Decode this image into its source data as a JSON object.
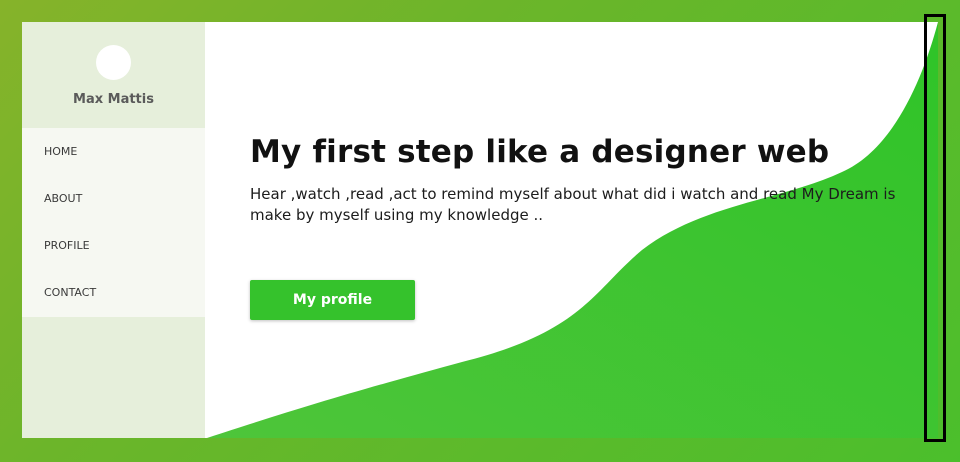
{
  "sidebar": {
    "user_name": "Max Mattis",
    "items": [
      {
        "label": "HOME"
      },
      {
        "label": "ABOUT"
      },
      {
        "label": "PROFILE"
      },
      {
        "label": "CONTACT"
      }
    ]
  },
  "hero": {
    "title": "My first step like a designer web",
    "description": "Hear ,watch ,read ,act to remind myself about what did i watch and read My Dream is make by myself using my knowledge ..",
    "button_label": "My profile"
  },
  "colors": {
    "accent": "#35c22c",
    "frame_background": "#6cb52a",
    "sidebar_background": "#e6efdb",
    "nav_background": "#f6f8f2"
  },
  "icons": [
    "avatar-placeholder"
  ]
}
